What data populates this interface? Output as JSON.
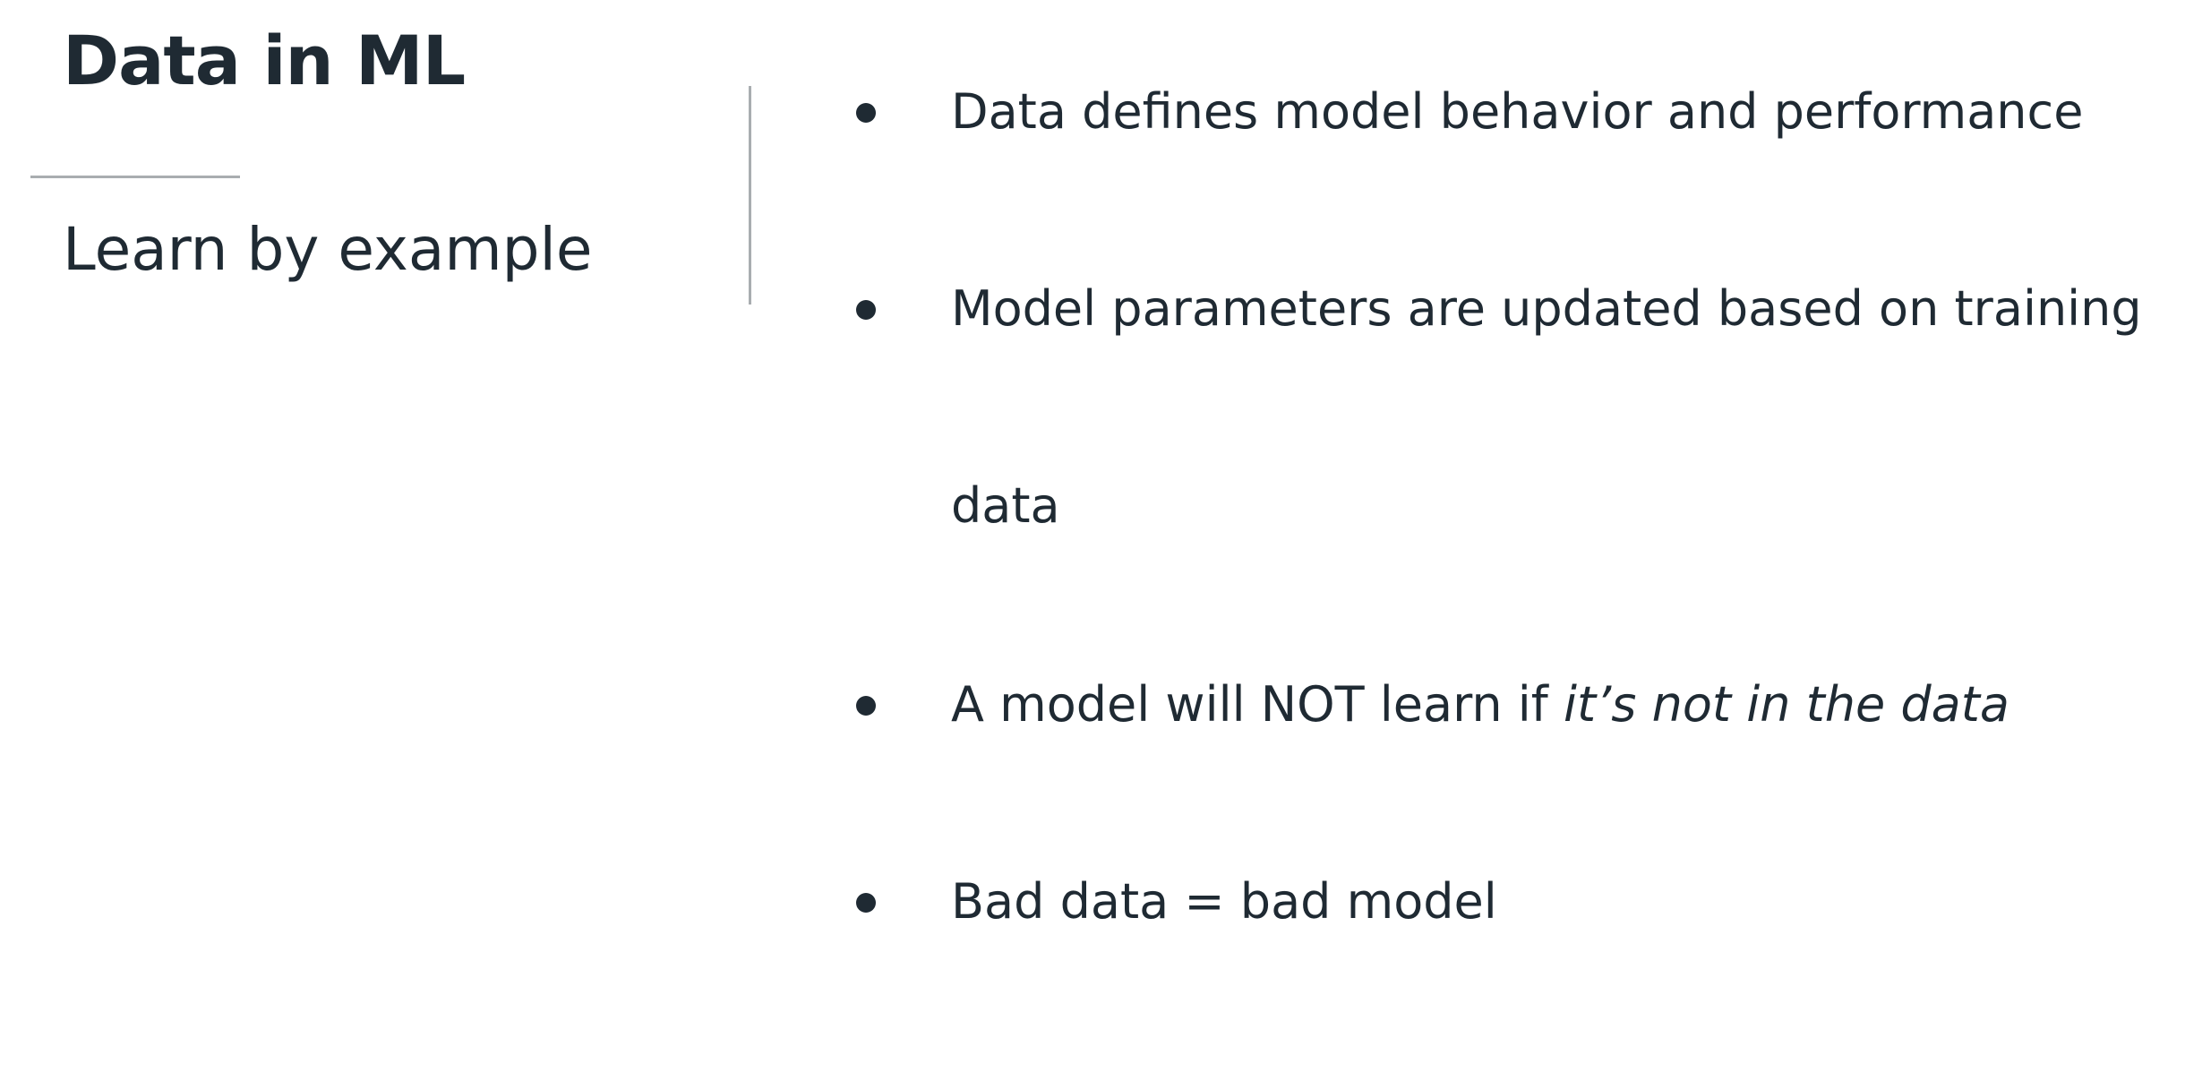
{
  "slide": {
    "title": "Data in ML",
    "subtitle": "Learn by example"
  },
  "bullets": [
    {
      "text": "Data defines model behavior and performance"
    },
    {
      "line1": "Model parameters are updated based on training",
      "line2": "data"
    },
    {
      "prefix": "A model will NOT learn if ",
      "emphasis": "it’s not in the data"
    },
    {
      "text": "Bad data = bad model"
    }
  ]
}
